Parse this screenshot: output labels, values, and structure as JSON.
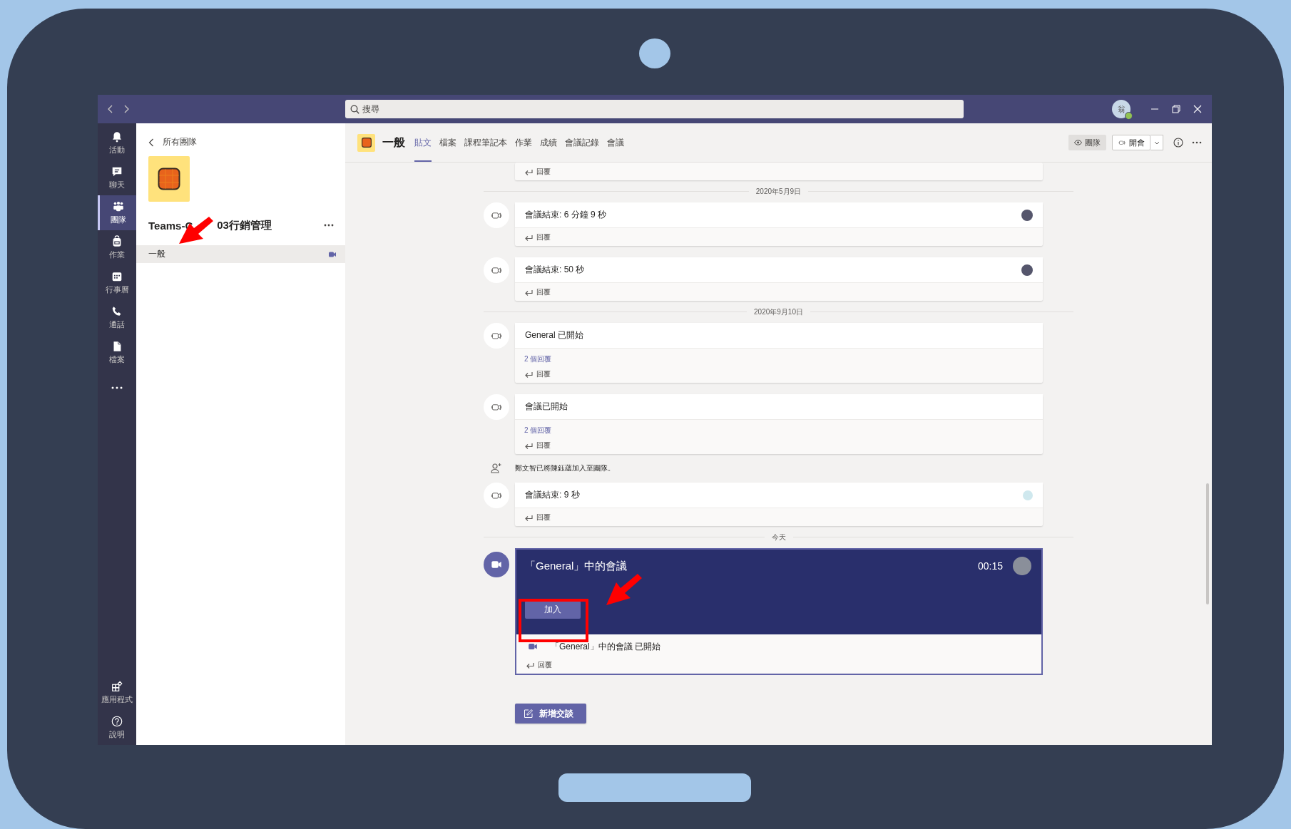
{
  "title_bar": {
    "search": {
      "placeholder": "搜尋"
    },
    "avatar_initial": "翁"
  },
  "app_bar": {
    "items": [
      {
        "kind": "bell",
        "label": "活動",
        "selected": false
      },
      {
        "kind": "chat",
        "label": "聊天",
        "selected": false
      },
      {
        "kind": "teams",
        "label": "團隊",
        "selected": true
      },
      {
        "kind": "backpack",
        "label": "作業",
        "selected": false
      },
      {
        "kind": "calendar",
        "label": "行事曆",
        "selected": false
      },
      {
        "kind": "phone",
        "label": "通話",
        "selected": false
      },
      {
        "kind": "file",
        "label": "檔案",
        "selected": false
      }
    ],
    "bottom_items": [
      {
        "kind": "apps",
        "label": "應用程式"
      },
      {
        "kind": "help",
        "label": "說明"
      }
    ]
  },
  "team_panel": {
    "back_label": "所有團隊",
    "team_name_parts": [
      "Teams-C",
      "03行銷管理"
    ],
    "channels": [
      {
        "name": "一般",
        "selected": true,
        "meeting_live": true
      }
    ]
  },
  "channel_header": {
    "name": "一般",
    "tabs": [
      {
        "label": "貼文",
        "selected": true
      },
      {
        "label": "檔案",
        "selected": false
      },
      {
        "label": "課程筆記本",
        "selected": false
      },
      {
        "label": "作業",
        "selected": false
      },
      {
        "label": "成績",
        "selected": false
      },
      {
        "label": "會議記錄",
        "selected": false
      },
      {
        "label": "會議",
        "selected": false
      }
    ],
    "team_button": "團隊",
    "meet_button": "開會"
  },
  "feed": [
    {
      "kind": "reply_stub",
      "reply_label": "回覆"
    },
    {
      "kind": "date",
      "label": "2020年5月9日"
    },
    {
      "kind": "meeting_card",
      "title": "會議結束: 6 分鐘 9 秒",
      "avatar": {
        "kind": "photo"
      },
      "reply_label": "回覆"
    },
    {
      "kind": "meeting_card",
      "title": "會議結束: 50 秒",
      "avatar": {
        "kind": "photo"
      },
      "reply_label": "回覆"
    },
    {
      "kind": "date",
      "label": "2020年9月10日"
    },
    {
      "kind": "meeting_card",
      "title": "General 已開始",
      "replies_link": "2 個回覆",
      "reply_label": "回覆"
    },
    {
      "kind": "meeting_card",
      "title": "會議已開始",
      "replies_link": "2 個回覆",
      "reply_label": "回覆"
    },
    {
      "kind": "system",
      "text": "鄭文智已將陳鈺蘊加入至團隊。"
    },
    {
      "kind": "meeting_card",
      "title": "會議結束: 9 秒",
      "avatar": {
        "kind": "initials"
      },
      "reply_label": "回覆"
    },
    {
      "kind": "date",
      "label": "今天"
    },
    {
      "kind": "live_meeting",
      "title": "「General」中的會議",
      "duration": "00:15",
      "avatar": {
        "kind": "photo"
      },
      "join_button": "加入",
      "status": "「General」中的會議 已開始",
      "reply_label": "回覆"
    }
  ],
  "new_conversation_button": "新增交談"
}
